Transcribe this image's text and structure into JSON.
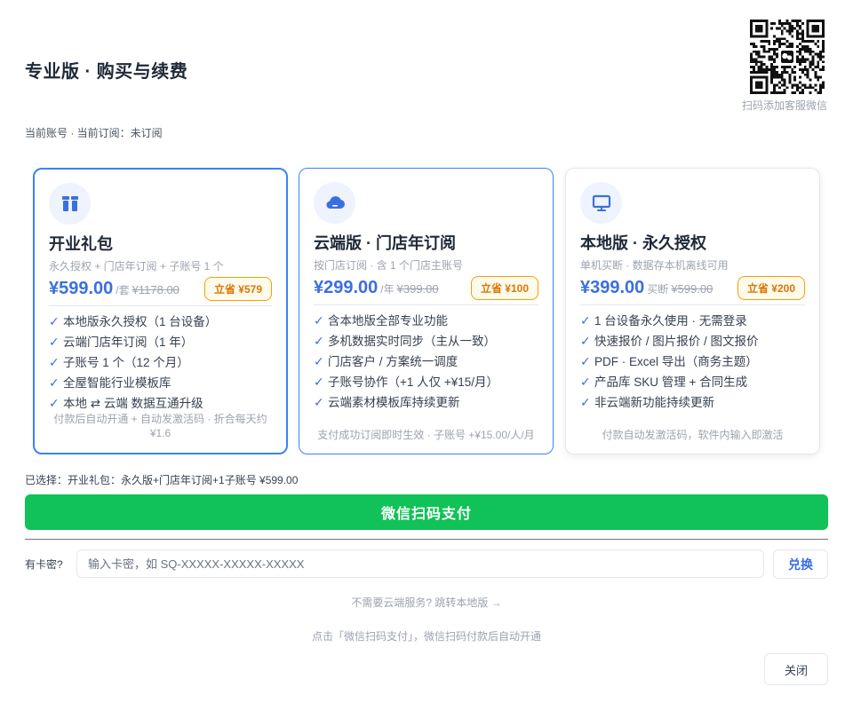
{
  "header": {
    "title": "专业版 · 购买与续费",
    "account_status": "当前账号 · 当前订阅：未订阅",
    "qr_caption": "扫码添加客服微信"
  },
  "plans": [
    {
      "icon": "gift-icon",
      "name": "开业礼包",
      "subtitle": "永久授权 + 门店年订阅 + 子账号 1 个",
      "price": "¥599.00",
      "unit": "/套",
      "original_price": "¥1178.00",
      "save_badge": "立省 ¥579",
      "features": [
        "本地版永久授权（1 台设备）",
        "云端门店年订阅（1 年）",
        "子账号 1 个（12 个月）",
        "全屋智能行业模板库",
        "本地 ⇄ 云端 数据互通升级"
      ],
      "footer": "付款后自动开通 + 自动发激活码 · 折合每天约 ¥1.6",
      "state": "selected"
    },
    {
      "icon": "cloud-icon",
      "name": "云端版 · 门店年订阅",
      "subtitle": "按门店订阅 · 含 1 个门店主账号",
      "price": "¥299.00",
      "unit": "/年",
      "original_price": "¥399.00",
      "save_badge": "立省 ¥100",
      "features": [
        "含本地版全部专业功能",
        "多机数据实时同步（主从一致）",
        "门店客户 / 方案统一调度",
        "子账号协作（+1 人仅 +¥15/月）",
        "云端素材模板库持续更新"
      ],
      "footer": "支付成功订阅即时生效 · 子账号 +¥15.00/人/月",
      "state": "hover"
    },
    {
      "icon": "monitor-icon",
      "name": "本地版 · 永久授权",
      "subtitle": "单机买断 · 数据存本机离线可用",
      "price": "¥399.00",
      "unit": "买断",
      "original_price": "¥599.00",
      "save_badge": "立省 ¥200",
      "features": [
        "1 台设备永久使用 · 无需登录",
        "快速报价 / 图片报价 / 图文报价",
        "PDF · Excel 导出（商务主题）",
        "产品库 SKU 管理 + 合同生成",
        "非云端新功能持续更新"
      ],
      "footer": "付款自动发激活码，软件内输入即激活",
      "state": "plain"
    }
  ],
  "selection_text": "已选择：开业礼包：永久版+门店年订阅+1子账号  ¥599.00",
  "pay_button": "微信扫码支付",
  "redeem": {
    "label": "有卡密?",
    "placeholder": "输入卡密，如 SQ-XXXXX-XXXXX-XXXXX",
    "value": "",
    "button": "兑换"
  },
  "local_link": "不需要云端服务? 跳转本地版 →",
  "hint": "点击「微信扫码支付」，微信扫码付款后自动开通",
  "close_button": "关闭",
  "colors": {
    "accent": "#3b6fe0",
    "pay_green": "#10c257",
    "badge_orange": "#f59e0b"
  }
}
